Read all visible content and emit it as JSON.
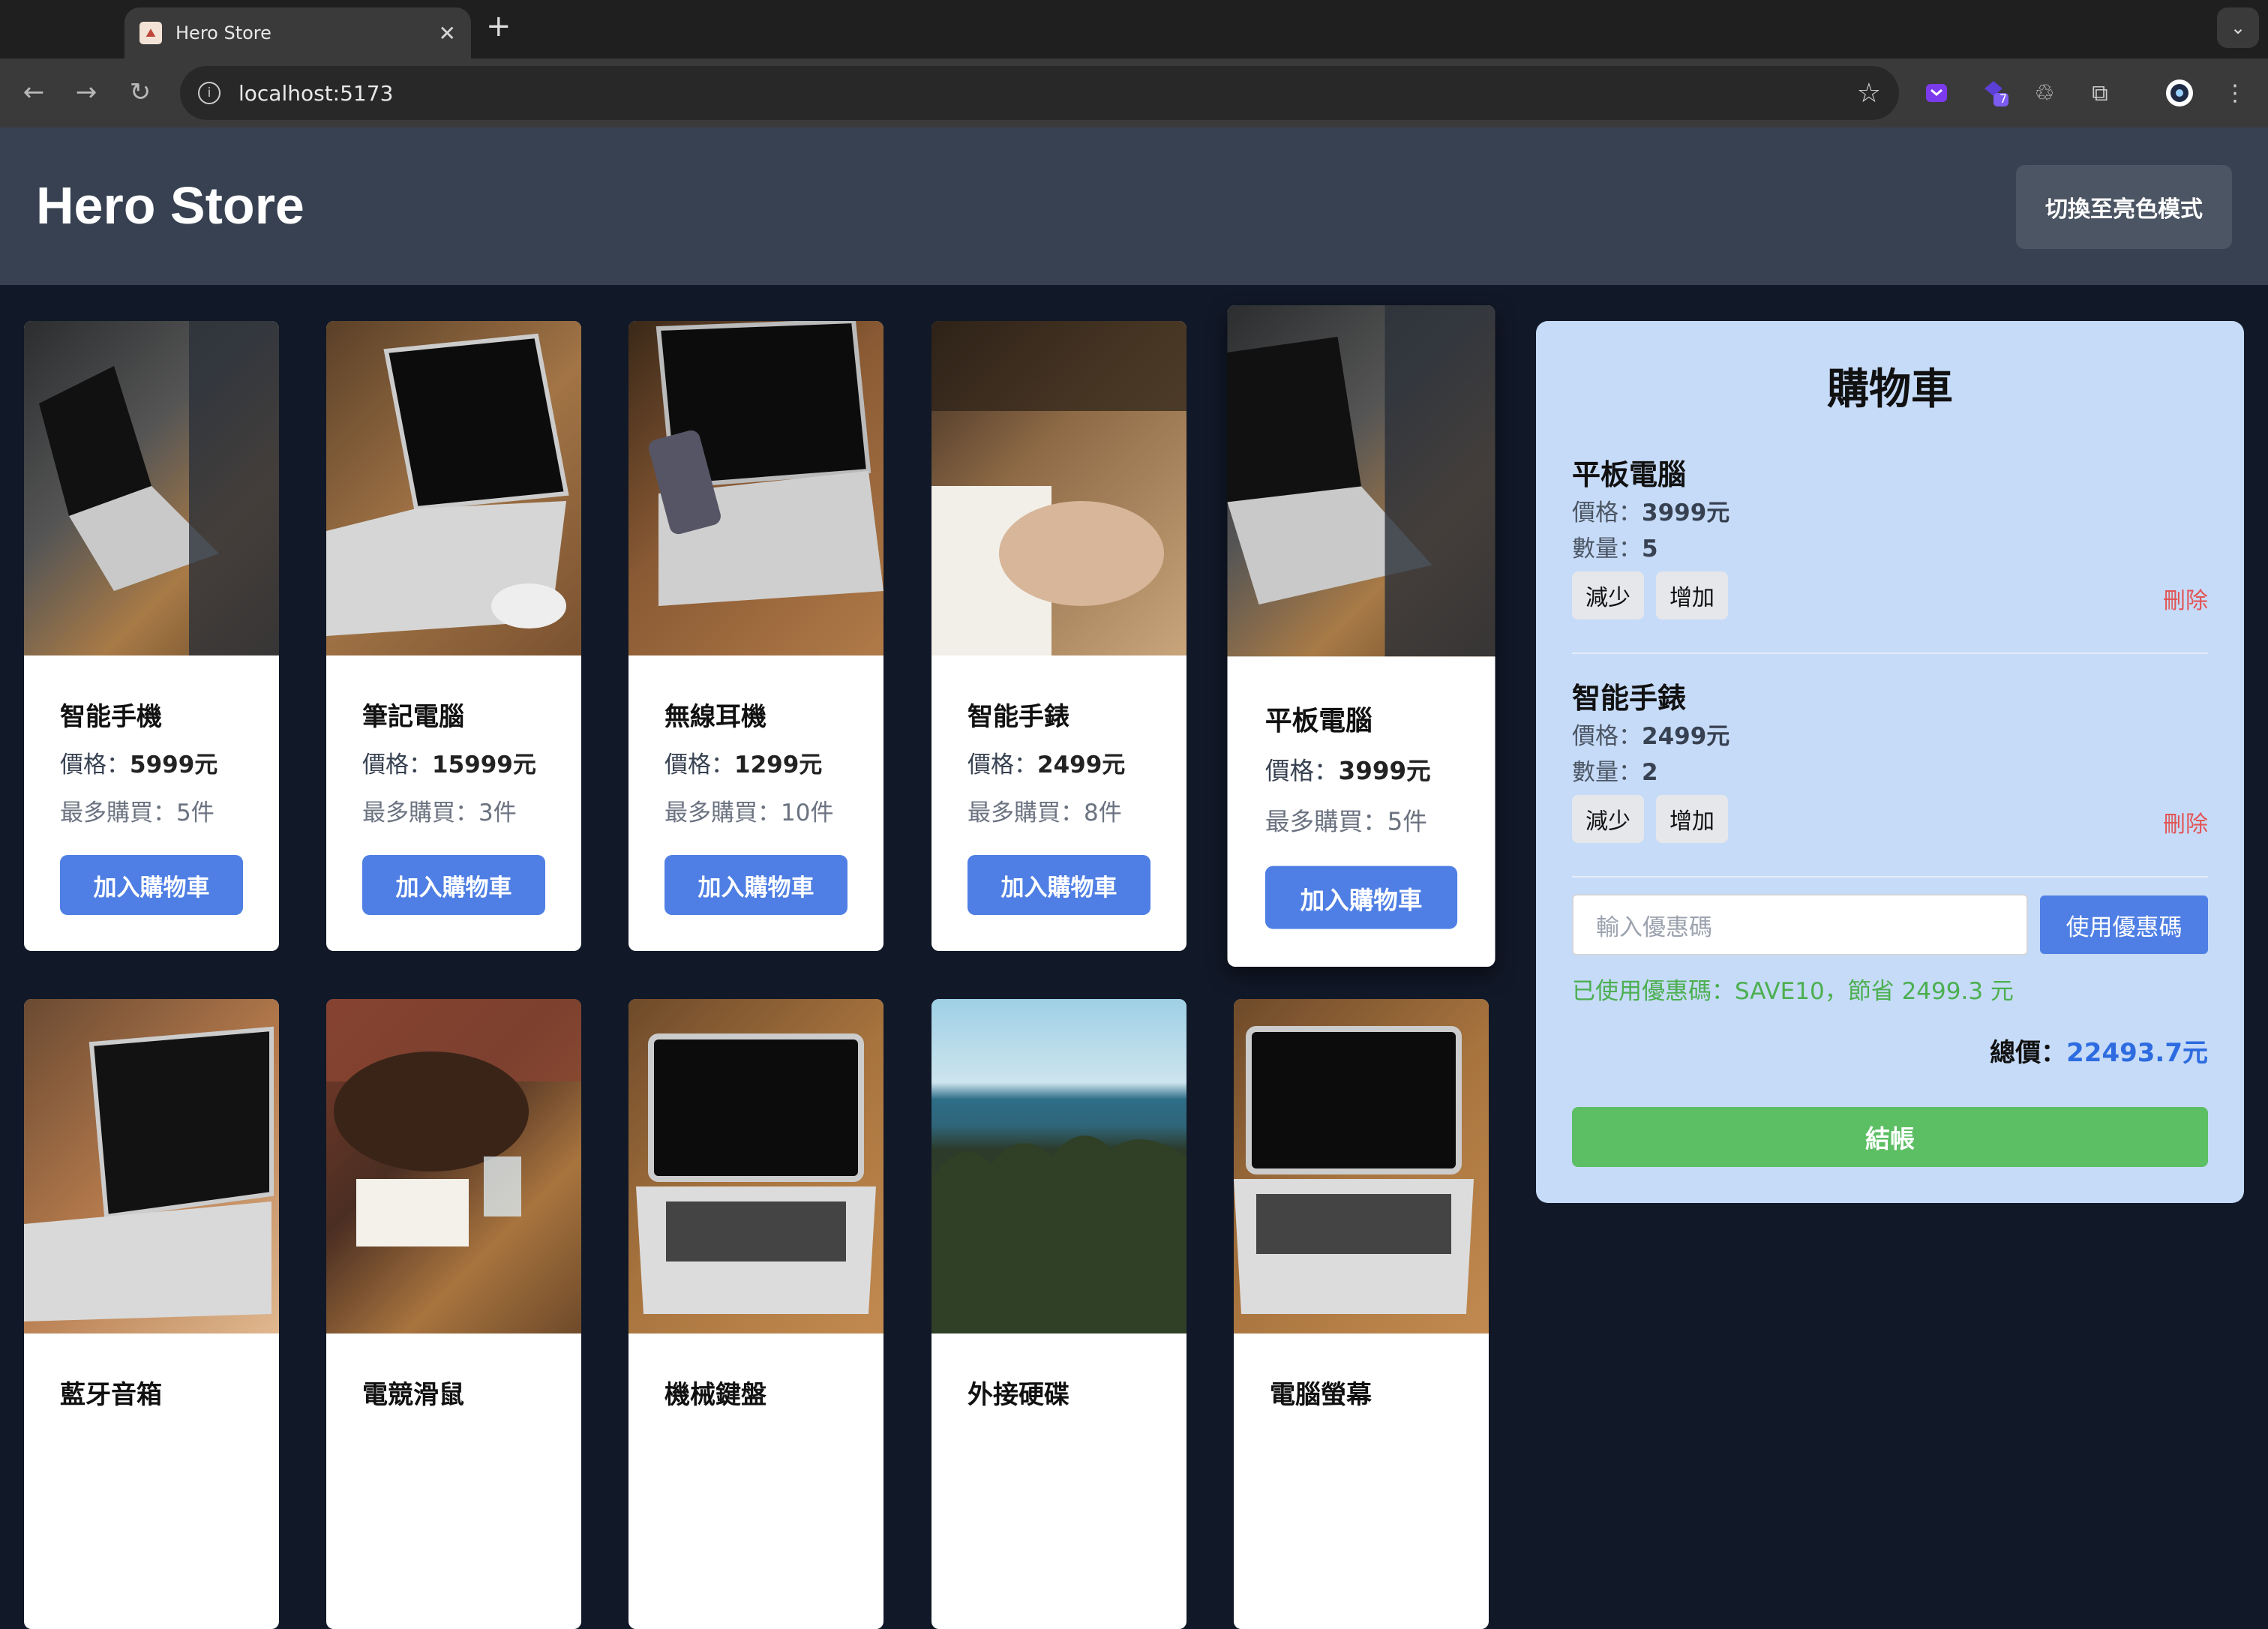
{
  "browser": {
    "tab_title": "Hero Store",
    "tab_favicon": "mountain-icon",
    "url": "localhost:5173",
    "extension_badge": "7"
  },
  "header": {
    "brand": "Hero Store",
    "theme_button": "切換至亮色模式"
  },
  "products": [
    {
      "name": "智能手機",
      "price_label": "價格：",
      "price": "5999元",
      "max": "最多購買：5件",
      "add": "加入購物車"
    },
    {
      "name": "筆記電腦",
      "price_label": "價格：",
      "price": "15999元",
      "max": "最多購買：3件",
      "add": "加入購物車"
    },
    {
      "name": "無線耳機",
      "price_label": "價格：",
      "price": "1299元",
      "max": "最多購買：10件",
      "add": "加入購物車"
    },
    {
      "name": "智能手錶",
      "price_label": "價格：",
      "price": "2499元",
      "max": "最多購買：8件",
      "add": "加入購物車"
    },
    {
      "name": "平板電腦",
      "price_label": "價格：",
      "price": "3999元",
      "max": "最多購買：5件",
      "add": "加入購物車"
    },
    {
      "name": "藍牙音箱"
    },
    {
      "name": "電競滑鼠"
    },
    {
      "name": "機械鍵盤"
    },
    {
      "name": "外接硬碟"
    },
    {
      "name": "電腦螢幕"
    }
  ],
  "cart": {
    "title": "購物車",
    "items": [
      {
        "name": "平板電腦",
        "price_label": "價格：",
        "price": "3999元",
        "qty_label": "數量：",
        "qty": "5",
        "dec": "減少",
        "inc": "增加",
        "remove": "刪除"
      },
      {
        "name": "智能手錶",
        "price_label": "價格：",
        "price": "2499元",
        "qty_label": "數量：",
        "qty": "2",
        "dec": "減少",
        "inc": "增加",
        "remove": "刪除"
      }
    ],
    "coupon_placeholder": "輸入優惠碼",
    "apply_coupon": "使用優惠碼",
    "coupon_message": "已使用優惠碼：SAVE10，節省 2499.3 元",
    "total_label": "總價：",
    "total": "22493.7元",
    "checkout": "結帳"
  },
  "colors": {
    "page_bg": "#111827",
    "header_bg": "#374151",
    "primary": "#4f7fe4",
    "cart_bg": "#c6dbf8",
    "success": "#5cbf63",
    "danger": "#e25555"
  }
}
